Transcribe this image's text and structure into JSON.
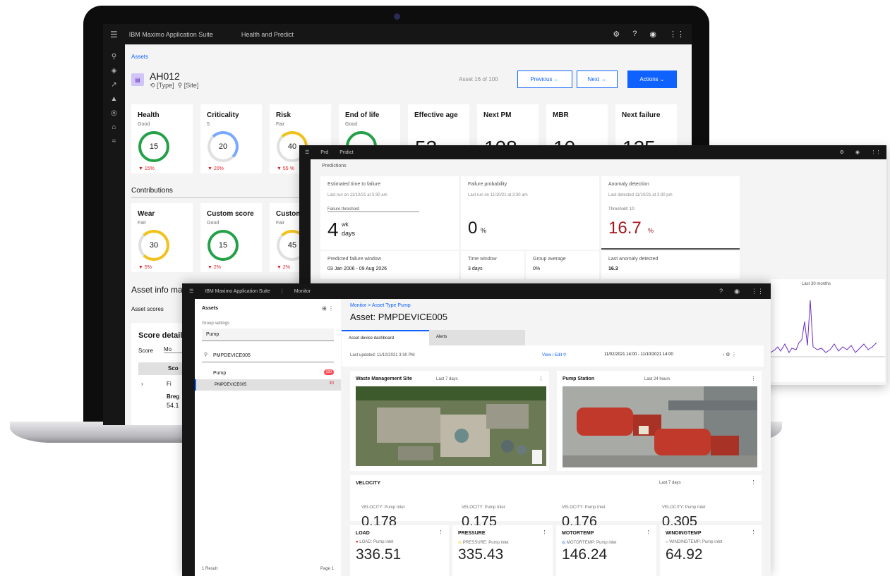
{
  "screen1": {
    "app_title": "IBM Maximo Application Suite",
    "module": "Health and Predict",
    "breadcrumb": "Assets",
    "asset_id": "AH012",
    "asset_type": "[Type]",
    "asset_site": "[Site]",
    "asset_count": "Asset 16 of 100",
    "btn_previous": "Previous ←",
    "btn_next": "Next →",
    "btn_actions": "Actions ⌄",
    "cards": [
      {
        "title": "Health",
        "sub": "Good",
        "value": "15",
        "delta": "▼ 15%"
      },
      {
        "title": "Criticality",
        "sub": "5",
        "value": "20",
        "delta": "▼ 20%"
      },
      {
        "title": "Risk",
        "sub": "Fair",
        "value": "40",
        "delta": "▼ 55 %"
      },
      {
        "title": "End of life",
        "sub": "Good"
      },
      {
        "title": "Effective age",
        "value": "53"
      },
      {
        "title": "Next PM",
        "value": "108"
      },
      {
        "title": "MBR",
        "value": "10"
      },
      {
        "title": "Next failure",
        "value": "125"
      }
    ],
    "contrib_label": "Contributions",
    "contrib_cards": [
      {
        "title": "Wear",
        "sub": "Fair",
        "value": "30",
        "delta": "▼ 5%"
      },
      {
        "title": "Custom score",
        "sub": "Good",
        "value": "15",
        "delta": "▼ 2%"
      },
      {
        "title": "Custom",
        "sub": "Fair",
        "value": "45",
        "delta": "▼ 2%"
      }
    ],
    "info_label": "Asset info ma",
    "asset_scores_label": "Asset scores",
    "score_details": "Score detail",
    "score_col": "Score",
    "score_col2": "Mo",
    "score_row": "Sco",
    "row_a": "Fi",
    "row_b": "Breg",
    "row_c": "54.1"
  },
  "screen2": {
    "tb1": "Prd",
    "tb2": "Pridict",
    "section": "Predictions",
    "card1": {
      "label": "Estimated time to failure",
      "meta": "Last run on 11/10/21 at 3:30 am",
      "sel": "Failure threshold",
      "value": "4",
      "unit1": "wk",
      "unit2": "days",
      "foot_label": "Predicted failure window",
      "foot_value": "03 Jan 2006 - 09 Aug 2026"
    },
    "card2": {
      "label": "Failure probability",
      "meta": "Last run on 11/10/21 at 3:30 am",
      "value": "0",
      "unit": "%",
      "foot_label1": "Time window",
      "foot_value1": "3 days",
      "foot_label2": "Group average",
      "foot_value2": "0%"
    },
    "card3": {
      "label": "Anomaly detection",
      "meta": "Last detected 11/10/21 at 3:30 pm",
      "sub": "Threshold: 10",
      "value": "16.7",
      "unit": "%",
      "foot_label": "Last anomaly detected",
      "foot_value": "16.3"
    },
    "chart_label": "Last 30 months"
  },
  "screen3": {
    "app_title": "IBM Maximo Application Suite",
    "module": "Monitor",
    "panel_title": "Assets",
    "dropdown_label": "Group settings",
    "dropdown_value": "Pump",
    "search_value": "PMPDEVICE005",
    "list_group": "Pump",
    "list_group_count": "120",
    "list_item": "PMPDEVICE005",
    "list_item_count": "30",
    "footer_left": "1 Result",
    "footer_right": "Page 1",
    "crumb": "Monitor > Asset Type Pump",
    "asset_title": "Asset: PMPDEVICE005",
    "tab1": "Asset device dashboard",
    "tab2": "Alerts",
    "last_updated": "Last updated: 11/10/2021 3:30 PM",
    "time_window": "11/02/2021 14:00 - 11/10/2021 14:00",
    "tile_map_title": "Waste Management Site",
    "tile_map_range": "Last 7 days",
    "tile_photo_title": "Pump Station",
    "tile_photo_range": "Last 24 hours",
    "velocity_title": "VELOCITY",
    "velocity_range": "Last 7 days",
    "velocity": [
      {
        "label": "VELOCITY: Pump Inlet",
        "value": "0.178"
      },
      {
        "label": "VELOCITY: Pump Inlet",
        "value": "0.175"
      },
      {
        "label": "VELOCITY: Pump Inlet",
        "value": "0.176"
      },
      {
        "label": "VELOCITY: Pump Inlet",
        "value": "0.305"
      }
    ],
    "tiles": [
      {
        "title": "LOAD",
        "sub": "LOAD: Pump inlet",
        "value": "336.51"
      },
      {
        "title": "PRESSURE",
        "sub": "PRESSURE: Pump inlet",
        "value": "335.43"
      },
      {
        "title": "MOTORTEMP",
        "sub": "MOTORTEMP: Pump inlet",
        "value": "146.24"
      },
      {
        "title": "WINDINGTEMP",
        "sub": "WINDINGTEMP: Pump inlet",
        "value": "64.92"
      }
    ]
  }
}
